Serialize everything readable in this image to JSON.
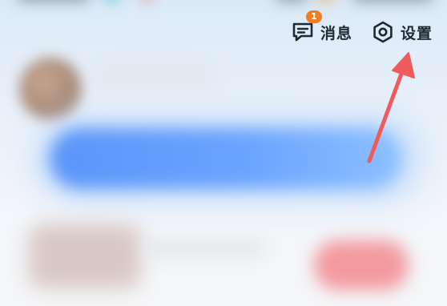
{
  "header": {
    "messages": {
      "label": "消息",
      "badge_count": "1",
      "icon": "message-icon"
    },
    "settings": {
      "label": "设置",
      "icon": "settings-gear-icon"
    }
  },
  "annotation": {
    "arrow_color": "#f05a5a",
    "points_to": "settings"
  },
  "colors": {
    "badge": "#f07d22",
    "primary_blurred_button": "#5b95f8",
    "blurred_red_button": "#f39aa0"
  }
}
